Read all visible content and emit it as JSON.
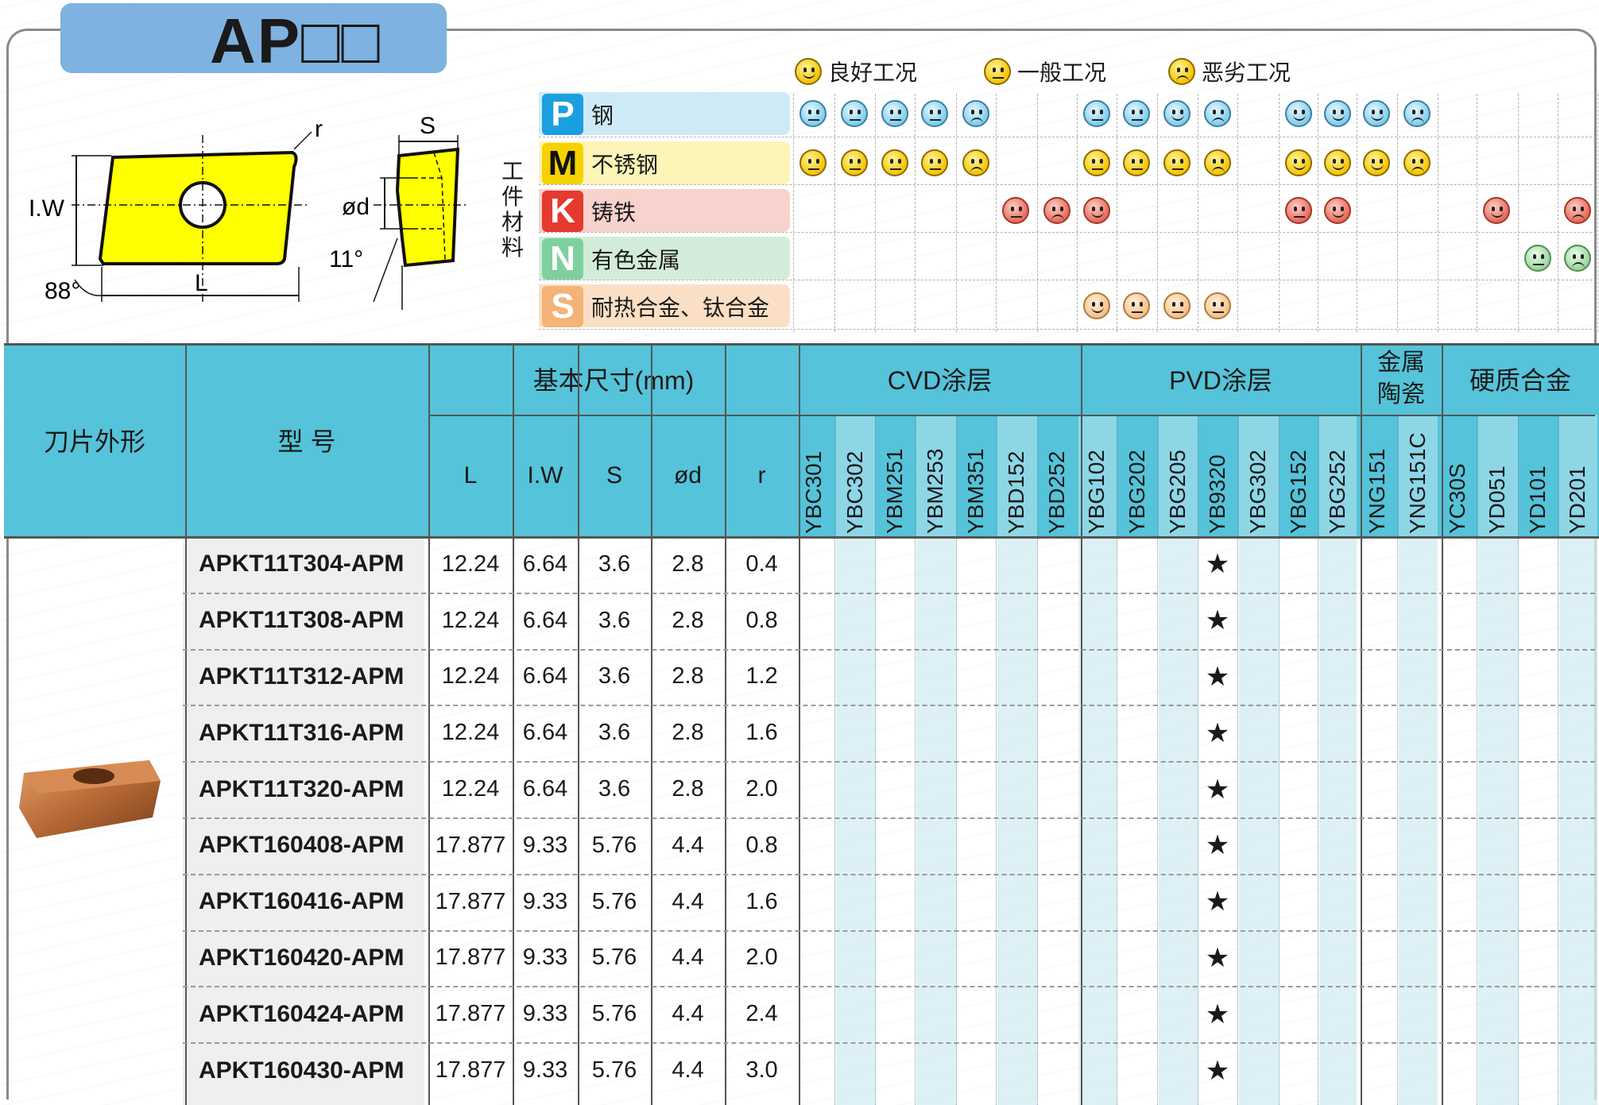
{
  "title": "AP□□",
  "legend": [
    {
      "label": "良好工况",
      "face": "good"
    },
    {
      "label": "一般工况",
      "face": "neutral"
    },
    {
      "label": "恶劣工况",
      "face": "bad"
    }
  ],
  "material_axis_label": "工件材料",
  "materials": [
    {
      "code": "P",
      "name": "钢",
      "color": "#1a9fe0",
      "band": "#cfeaf7"
    },
    {
      "code": "M",
      "name": "不锈钢",
      "color": "#f5d200",
      "band": "#fdf4b8"
    },
    {
      "code": "K",
      "name": "铸铁",
      "color": "#e63a2e",
      "band": "#f8d2cd"
    },
    {
      "code": "N",
      "name": "有色金属",
      "color": "#7fd0a0",
      "band": "#d3ecd9"
    },
    {
      "code": "S",
      "name": "耐热合金、钛合金",
      "color": "#f5b377",
      "band": "#fbdfc4"
    }
  ],
  "diagram": {
    "labels": {
      "r": "r",
      "iw": "I.W",
      "L": "L",
      "angle88": "88°",
      "S": "S",
      "d": "ød",
      "angle11": "11°"
    }
  },
  "table": {
    "headers": {
      "shape": "刀片外形",
      "model": "型 号",
      "dims": "基本尺寸(mm)",
      "cvd": "CVD涂层",
      "pvd": "PVD涂层",
      "cermet": "金属陶瓷",
      "carbide": "硬质合金"
    },
    "dim_cols": [
      "L",
      "I.W",
      "S",
      "ød",
      "r"
    ],
    "grades": [
      "YBC301",
      "YBC302",
      "YBM251",
      "YBM253",
      "YBM351",
      "YBD152",
      "YBD252",
      "YBG102",
      "YBG202",
      "YBG205",
      "YB9320",
      "YBG302",
      "YBG152",
      "YBG252",
      "YNG151",
      "YNG151C",
      "YC30S",
      "YD051",
      "YD101",
      "YD201"
    ],
    "rows": [
      {
        "model": "APKT11T304-APM",
        "L": "12.24",
        "IW": "6.64",
        "S": "3.6",
        "d": "2.8",
        "r": "0.4",
        "star": "★"
      },
      {
        "model": "APKT11T308-APM",
        "L": "12.24",
        "IW": "6.64",
        "S": "3.6",
        "d": "2.8",
        "r": "0.8",
        "star": "★"
      },
      {
        "model": "APKT11T312-APM",
        "L": "12.24",
        "IW": "6.64",
        "S": "3.6",
        "d": "2.8",
        "r": "1.2",
        "star": "★"
      },
      {
        "model": "APKT11T316-APM",
        "L": "12.24",
        "IW": "6.64",
        "S": "3.6",
        "d": "2.8",
        "r": "1.6",
        "star": "★"
      },
      {
        "model": "APKT11T320-APM",
        "L": "12.24",
        "IW": "6.64",
        "S": "3.6",
        "d": "2.8",
        "r": "2.0",
        "star": "★"
      },
      {
        "model": "APKT160408-APM",
        "L": "17.877",
        "IW": "9.33",
        "S": "5.76",
        "d": "4.4",
        "r": "0.8",
        "star": "★"
      },
      {
        "model": "APKT160416-APM",
        "L": "17.877",
        "IW": "9.33",
        "S": "5.76",
        "d": "4.4",
        "r": "1.6",
        "star": "★"
      },
      {
        "model": "APKT160420-APM",
        "L": "17.877",
        "IW": "9.33",
        "S": "5.76",
        "d": "4.4",
        "r": "2.0",
        "star": "★"
      },
      {
        "model": "APKT160424-APM",
        "L": "17.877",
        "IW": "9.33",
        "S": "5.76",
        "d": "4.4",
        "r": "2.4",
        "star": "★"
      },
      {
        "model": "APKT160430-APM",
        "L": "17.877",
        "IW": "9.33",
        "S": "5.76",
        "d": "4.4",
        "r": "3.0",
        "star": "★"
      }
    ]
  }
}
